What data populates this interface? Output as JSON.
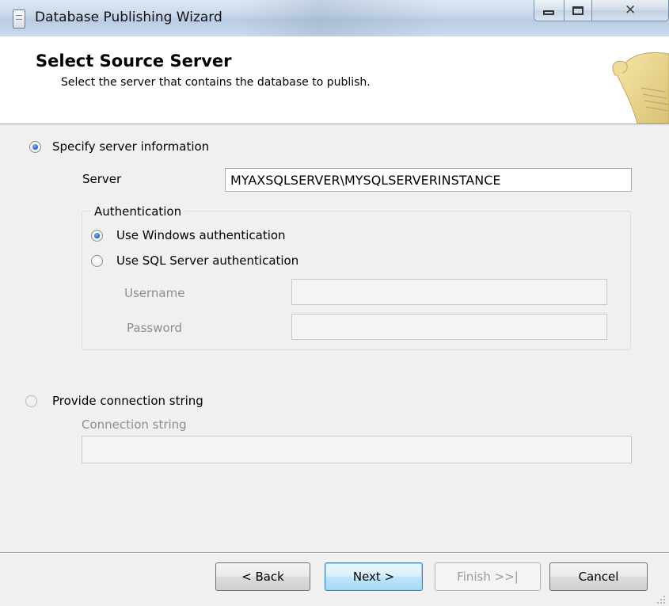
{
  "window": {
    "title": "Database Publishing Wizard",
    "controls": {
      "minimize": "minimize-icon",
      "maximize": "maximize-icon",
      "close": "close-icon"
    }
  },
  "header": {
    "title": "Select Source Server",
    "subtitle": "Select the server that contains the database to publish.",
    "icon": "scroll-icon"
  },
  "server_section": {
    "radio_label": "Specify server information",
    "selected": true,
    "server_label": "Server",
    "server_value": "MYAXSQLSERVER\\MYSQLSERVERINSTANCE",
    "authentication": {
      "legend": "Authentication",
      "windows_label": "Use Windows authentication",
      "windows_selected": true,
      "sql_label": "Use SQL Server authentication",
      "sql_selected": false,
      "username_label": "Username",
      "username_value": "",
      "password_label": "Password",
      "password_value": ""
    }
  },
  "connection_section": {
    "radio_label": "Provide connection string",
    "selected": false,
    "connection_label": "Connection string",
    "connection_value": ""
  },
  "footer": {
    "back_label": "< Back",
    "next_label": "Next >",
    "finish_label": "Finish >>|",
    "cancel_label": "Cancel"
  }
}
